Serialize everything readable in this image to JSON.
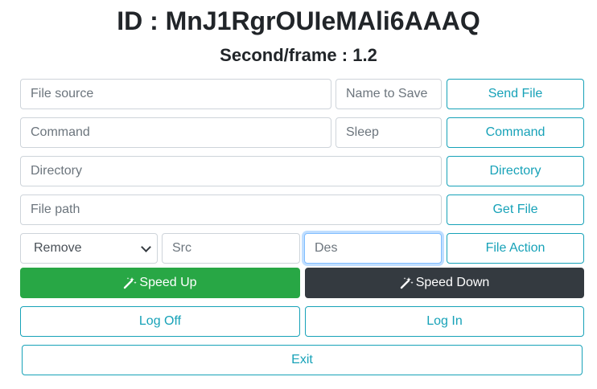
{
  "header": {
    "id_text": "ID : MnJ1RgrOUIeMAli6AAAQ",
    "rate_text": "Second/frame : 1.2"
  },
  "send_row": {
    "file_source_placeholder": "File source",
    "name_to_save_placeholder": "Name to Save",
    "send_file_label": "Send File"
  },
  "command_row": {
    "command_placeholder": "Command",
    "sleep_placeholder": "Sleep",
    "command_label": "Command"
  },
  "directory_row": {
    "directory_placeholder": "Directory",
    "directory_label": "Directory"
  },
  "getfile_row": {
    "file_path_placeholder": "File path",
    "get_file_label": "Get File"
  },
  "action_row": {
    "action_selected": "Remove",
    "src_placeholder": "Src",
    "des_placeholder": "Des",
    "file_action_label": "File Action"
  },
  "speed_row": {
    "speed_up_label": "Speed Up",
    "speed_down_label": "Speed Down",
    "icon": "magic-wand-icon"
  },
  "session_row": {
    "log_off_label": "Log Off",
    "log_in_label": "Log In"
  },
  "exit_label": "Exit",
  "colors": {
    "accent": "#17a2b8",
    "success": "#28a745",
    "dark": "#343a40",
    "focus": "#80bdff"
  }
}
